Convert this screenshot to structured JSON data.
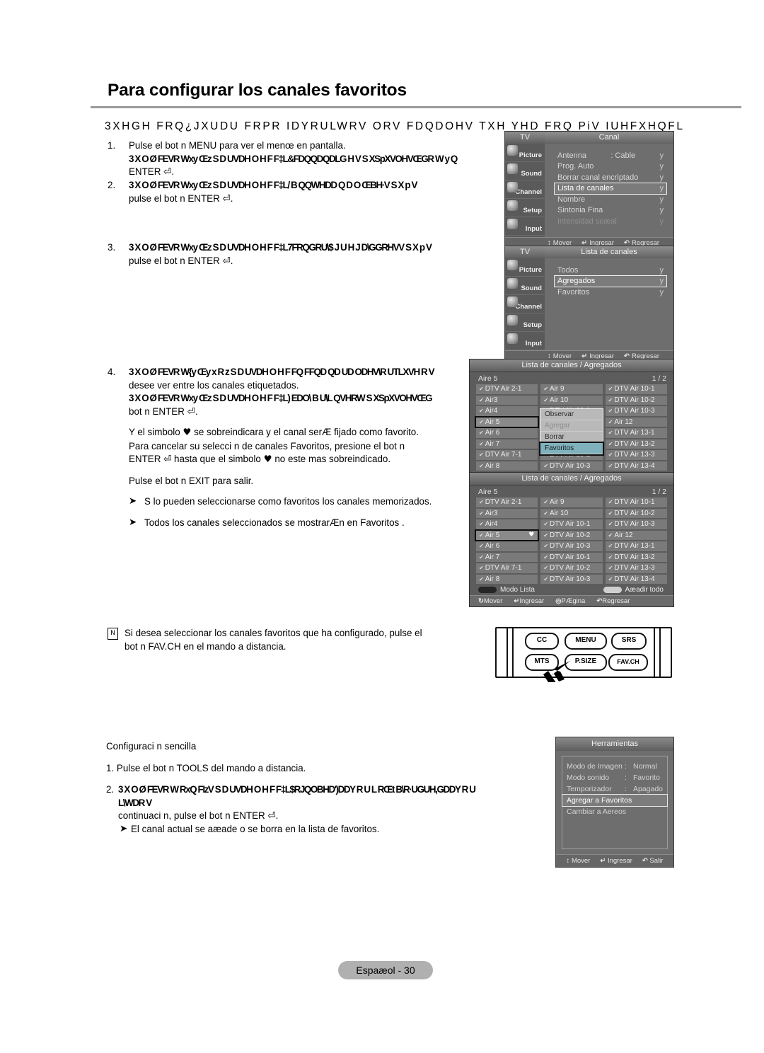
{
  "page": {
    "title": "Para configurar los canales favoritos",
    "intro_garbled": "3XHGH FRQ¿JXUDU FRPR IDYRULWRV ORV FDQDOHV TXH YHD FRQ PiV IUHFXHQFL",
    "footer": "Espaæol - 30"
  },
  "steps": [
    {
      "num": "1.",
      "line1": "Pulse el bot n  MENU para ver el menœ en pantalla.",
      "line2_garbled": "3 X O Ø FEVR Wxy Œz  S D UVDH O H F F‡L&FDQQDQDLG H V S XSpXVOHVŒGR W y Q",
      "line3": "ENTER ⏎."
    },
    {
      "num": "2.",
      "line1_garbled": "3 X O Ø FEVR Wxy Œz  S D UVDH O H F F‡L/ B QQWHDD Q D O ŒBH·V S X p V",
      "line2": "pulse el bot n  ENTER ⏎."
    },
    {
      "num": "3.",
      "line1_garbled": "3 X O Ø FEVR Wxy Œz  S D UVDH O H F F‡L7FRQGRU\\$ J U H J D\\GGRHVV S X p V",
      "line2": "pulse el bot n  ENTER ⏎."
    },
    {
      "num": "4.",
      "line1_garbled": "3 X O Ø FEVR W{y Œy  x  R z  S D UVDH O H F FQ FFQD QD UD ODHV\\R UTLXVH R V",
      "line2": "desee ver entre los canales etiquetados.",
      "line3_garbled": "3 X O Ø FEVR Wxy Œz  S D UVDH O H F F‡L) EDO\\ B U\\L QVHRW S XSpXVOHVŒG",
      "line4": "bot n  ENTER ⏎.",
      "para1_a": "Y el simbolo ",
      "para1_b": " se sobreindicara y el canal serÆ fijado como favorito.",
      "para1_c": "Para cancelar su selecci n de canales Favoritos, presione el bot n",
      "para1_d": "ENTER ⏎ hasta que el simbolo ",
      "para1_e": " no este mas sobreindicado.",
      "para2": "Pulse el bot n  EXIT para salir.",
      "bullet1": "S lo pueden seleccionarse como favoritos los canales memorizados.",
      "bullet2": "Todos los canales seleccionados se mostrarÆn en  Favoritos ."
    }
  ],
  "note": {
    "icon": "book-icon",
    "line1": "Si desea seleccionar los canales favoritos que ha configurado, pulse el",
    "line2": "bot n  FAV.CH en el mando a distancia."
  },
  "simple_config": {
    "heading": "Configuraci n sencilla",
    "step1": "1. Pulse el bot n  TOOLS del mando a distancia.",
    "step2_num": "2.",
    "step2_garbled": "3 X O Ø FEVR W RxQ FIzV  S D UVDH O H F F‡L$RJQOBHD')DDY R U L RŒt B\\R·UGUH,GDDY R U L\\WDR V",
    "step2_line2": "continuaci n, pulse el bot n   ENTER ⏎.",
    "step2_bullet": "El canal actual se aæade o se borra en la lista de favoritos."
  },
  "osd_menus": [
    {
      "name": "canal-menu",
      "tv_label": "TV",
      "title": "Canal",
      "sidebar": [
        {
          "label": "Picture",
          "icon": "picture-icon"
        },
        {
          "label": "Sound",
          "icon": "sound-icon"
        },
        {
          "label": "Channel",
          "icon": "channel-icon"
        },
        {
          "label": "Setup",
          "icon": "setup-icon"
        },
        {
          "label": "Input",
          "icon": "input-icon"
        }
      ],
      "rows": [
        {
          "label": "Antenna",
          "value": ": Cable",
          "arrow": "y",
          "state": "normal"
        },
        {
          "label": "Prog.  Auto",
          "value": "",
          "arrow": "y",
          "state": "normal"
        },
        {
          "label": "Borrar canal encriptado",
          "value": "",
          "arrow": "y",
          "state": "normal"
        },
        {
          "label": "Lista de canales",
          "value": "",
          "arrow": "y",
          "state": "selected"
        },
        {
          "label": "Nombre",
          "value": "",
          "arrow": "y",
          "state": "normal"
        },
        {
          "label": "Sintonia  Fina",
          "value": "",
          "arrow": "y",
          "state": "normal"
        },
        {
          "label": "Intensidad seæal",
          "value": "",
          "arrow": "y",
          "state": "dim"
        }
      ],
      "footer": [
        {
          "icon": "updown-arrow-icon",
          "label": "Mover"
        },
        {
          "icon": "enter-icon",
          "label": "Ingresar"
        },
        {
          "icon": "return-icon",
          "label": "Regresar"
        }
      ]
    },
    {
      "name": "lista-de-canales-menu",
      "tv_label": "TV",
      "title": "Lista de canales",
      "sidebar": [
        {
          "label": "Picture",
          "icon": "picture-icon"
        },
        {
          "label": "Sound",
          "icon": "sound-icon"
        },
        {
          "label": "Channel",
          "icon": "channel-icon"
        },
        {
          "label": "Setup",
          "icon": "setup-icon"
        },
        {
          "label": "Input",
          "icon": "input-icon"
        }
      ],
      "rows": [
        {
          "label": "Todos",
          "value": "",
          "arrow": "y",
          "state": "normal"
        },
        {
          "label": "Agregados",
          "value": "",
          "arrow": "y",
          "state": "selected"
        },
        {
          "label": "Favoritos",
          "value": "",
          "arrow": "y",
          "state": "normal"
        }
      ],
      "footer": [
        {
          "icon": "updown-arrow-icon",
          "label": "Mover"
        },
        {
          "icon": "enter-icon",
          "label": "Ingresar"
        },
        {
          "icon": "return-icon",
          "label": "Regresar"
        }
      ]
    }
  ],
  "channel_lists": [
    {
      "name": "channel-list-popup",
      "title": "Lista de canales /   Agregados",
      "current": "Aire 5",
      "page": "1 / 2",
      "channels": [
        "DTV Air 2-1",
        "Air 9",
        "DTV Air 10-1",
        "Air3",
        "Air 10",
        "DTV Air 10-2",
        "Air4",
        "DTV Air 10-1",
        "DTV Air 10-3",
        "Air 5",
        "DTV Air 10-2",
        "Air 12",
        "Air 6",
        "DTV Air 10-3",
        "DTV Air 13-1",
        "Air 7",
        "DTV Air 10-1",
        "DTV Air 13-2",
        "DTV Air 7-1",
        "DTV Air 10-2",
        "DTV Air 13-3",
        "Air 8",
        "DTV Air 10-3",
        "DTV Air 13-4"
      ],
      "selected_index": 9,
      "popup_items": [
        {
          "label": "Observar",
          "state": "normal"
        },
        {
          "label": "Agregar",
          "state": "disabled"
        },
        {
          "label": "Borrar",
          "state": "normal"
        },
        {
          "label": "Favoritos",
          "state": "highlighted"
        }
      ],
      "btn_left": "Modo Lista",
      "btn_right": "Aæadir todo",
      "footer": [
        {
          "icon": "move-arrow-icon",
          "label": "Mover"
        },
        {
          "icon": "enter-icon",
          "label": "Ingresar"
        },
        {
          "icon": "return-icon",
          "label": "Regresar"
        }
      ]
    },
    {
      "name": "channel-list-favorited",
      "title": "Lista de canales /   Agregados",
      "current": "Aire 5",
      "page": "1 / 2",
      "channels": [
        "DTV Air 2-1",
        "Air 9",
        "DTV Air 10-1",
        "Air3",
        "Air 10",
        "DTV Air 10-2",
        "Air4",
        "DTV Air 10-1",
        "DTV Air 10-3",
        "Air 5",
        "DTV Air 10-2",
        "Air 12",
        "Air 6",
        "DTV Air 10-3",
        "DTV Air 13-1",
        "Air 7",
        "DTV Air 10-1",
        "DTV Air 13-2",
        "DTV Air 7-1",
        "DTV Air 10-2",
        "DTV Air 13-3",
        "Air 8",
        "DTV Air 10-3",
        "DTV Air 13-4"
      ],
      "selected_index": 9,
      "heart_marked": true,
      "btn_left": "Modo Lista",
      "btn_right": "Aæadir todo",
      "footer": [
        {
          "icon": "move-arrow-icon",
          "label": "Mover"
        },
        {
          "icon": "enter-icon",
          "label": "Ingresar"
        },
        {
          "icon": "page-icon",
          "label": "PÆgina"
        },
        {
          "icon": "return-icon",
          "label": "Regresar"
        }
      ]
    }
  ],
  "remote": {
    "buttons": [
      "CC",
      "MENU",
      "SRS",
      "MTS",
      "P.SIZE",
      "FAV.CH"
    ],
    "highlight": "FAV.CH"
  },
  "tools_menu": {
    "title": "Herramientas",
    "rows": [
      {
        "label": "Modo de Imagen",
        "sep": ":",
        "value": "Normal",
        "state": "normal"
      },
      {
        "label": "Modo sonido",
        "sep": ":",
        "value": "Favorito",
        "state": "normal"
      },
      {
        "label": "Temporizador",
        "sep": ":",
        "value": "Apagado",
        "state": "normal"
      },
      {
        "label": "Agregar a Favoritos",
        "sep": "",
        "value": "",
        "state": "selected"
      },
      {
        "label": "Cambiar a  Aereos",
        "sep": "",
        "value": "",
        "state": "normal"
      }
    ],
    "footer": [
      {
        "icon": "updown-arrow-icon",
        "label": "Mover"
      },
      {
        "icon": "enter-icon",
        "label": "Ingresar"
      },
      {
        "icon": "return-icon",
        "label": "Salir"
      }
    ]
  }
}
